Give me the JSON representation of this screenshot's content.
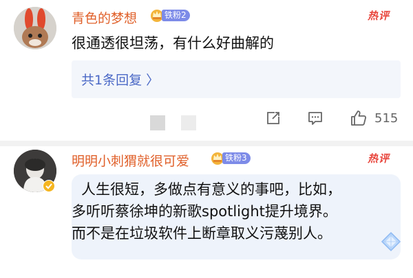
{
  "comment1": {
    "username": "青色的梦想",
    "fan_badge": "铁粉2",
    "hot_tag": "热评",
    "text": "很通透很坦荡，有什么好曲解的",
    "replies_label": "共1条回复 〉",
    "like_count": "515"
  },
  "comment2": {
    "username": "明明小刺猬就很可爱",
    "fan_badge": "铁粉3",
    "hot_tag": "热评",
    "lines": [
      "人生很短，多做点有意义的事吧，比如，",
      "多听听蔡徐坤的新歌spotlight提升境界。",
      "而不是在垃圾软件上断章取义污蔑别人。"
    ]
  },
  "colors": {
    "username": "#e0602a",
    "hot": "#e8453c",
    "badge": "#7d8be8",
    "reply_link": "#4a68c6"
  }
}
